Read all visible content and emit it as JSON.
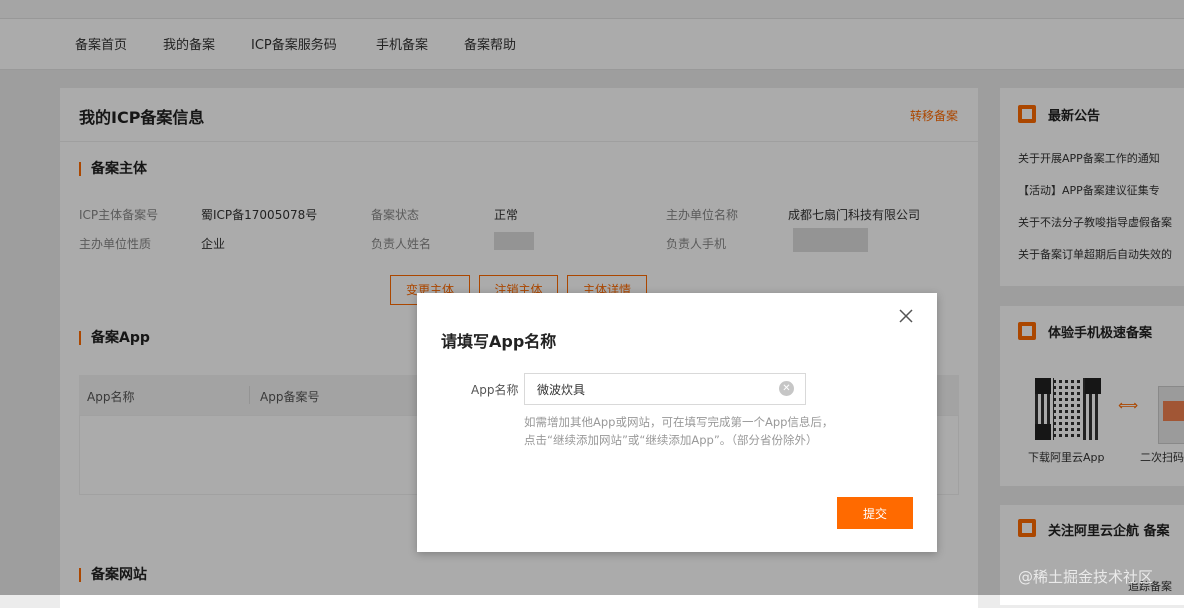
{
  "nav": {
    "items": [
      "备案首页",
      "我的备案",
      "ICP备案服务码",
      "手机备案",
      "备案帮助"
    ]
  },
  "main": {
    "title": "我的ICP备案信息",
    "transfer_link": "转移备案",
    "subject_section": {
      "title": "备案主体",
      "fields": {
        "icp_no_label": "ICP主体备案号",
        "icp_no_value": "蜀ICP备17005078号",
        "status_label": "备案状态",
        "status_value": "正常",
        "org_name_label": "主办单位名称",
        "org_name_value": "成都七扇门科技有限公司",
        "org_type_label": "主办单位性质",
        "org_type_value": "企业",
        "person_name_label": "负责人姓名",
        "person_phone_label": "负责人手机"
      },
      "buttons": [
        "变更主体",
        "注销主体",
        "主体详情"
      ]
    },
    "app_section": {
      "title": "备案App",
      "table_headers": [
        "App名称",
        "App备案号"
      ]
    },
    "website_section": {
      "title": "备案网站"
    }
  },
  "sidebar": {
    "news": {
      "title": "最新公告",
      "items": [
        "关于开展APP备案工作的通知",
        "【活动】APP备案建议征集专",
        "关于不法分子教唆指导虚假备案",
        "关于备案订单超期后自动失效的"
      ]
    },
    "mobile": {
      "title": "体验手机极速备案",
      "caption_left": "下载阿里云App",
      "caption_right": "二次扫码"
    },
    "follow": {
      "title": "关注阿里云企航 备案",
      "item": "追踪备案"
    }
  },
  "modal": {
    "title": "请填写App名称",
    "field_label": "App名称",
    "field_value": "微波炊具",
    "hint": "如需增加其他App或网站，可在填写完成第一个App信息后，点击“继续添加网站”或“继续添加App”。（部分省份除外）",
    "submit_label": "提交"
  },
  "watermark": "@稀土掘金技术社区"
}
